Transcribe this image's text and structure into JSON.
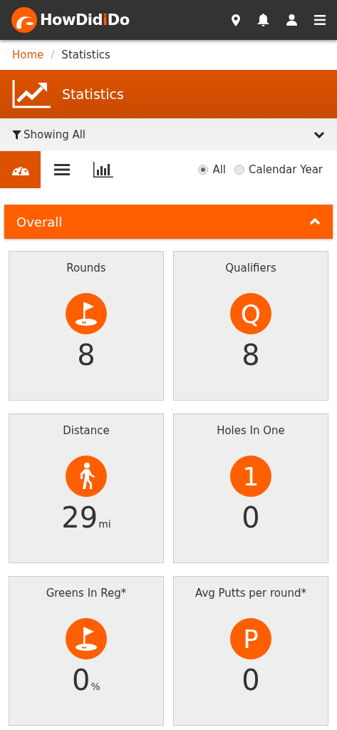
{
  "header": {
    "brand": {
      "before": "HowDid",
      "highlight": "i",
      "after": "Do"
    }
  },
  "breadcrumb": {
    "separator": "/",
    "items": [
      {
        "label": "Home",
        "link": true
      },
      {
        "label": "Statistics",
        "link": false
      }
    ]
  },
  "banner": {
    "title": "Statistics"
  },
  "filter": {
    "label": "Showing All",
    "expanded": false
  },
  "view_tabs": [
    {
      "kind": "dashboard",
      "selected": true
    },
    {
      "kind": "list",
      "selected": false
    },
    {
      "kind": "chart",
      "selected": false
    }
  ],
  "period": [
    {
      "label": "All",
      "selected": true
    },
    {
      "label": "Calendar Year",
      "selected": false
    }
  ],
  "section": {
    "title": "Overall",
    "expanded": true
  },
  "stats": [
    {
      "title": "Rounds",
      "icon": {
        "kind": "flag"
      },
      "value": "8"
    },
    {
      "title": "Qualifiers",
      "icon": {
        "kind": "letter",
        "text": "Q"
      },
      "value": "8"
    },
    {
      "title": "Distance",
      "icon": {
        "kind": "walker"
      },
      "value": "29",
      "unit": "mi"
    },
    {
      "title": "Holes In One",
      "icon": {
        "kind": "letter",
        "text": "1"
      },
      "value": "0"
    },
    {
      "title": "Greens In Reg*",
      "icon": {
        "kind": "flag"
      },
      "value": "0",
      "unit": "%"
    },
    {
      "title": "Avg Putts per round*",
      "icon": {
        "kind": "letter",
        "text": "P"
      },
      "value": "0"
    }
  ]
}
